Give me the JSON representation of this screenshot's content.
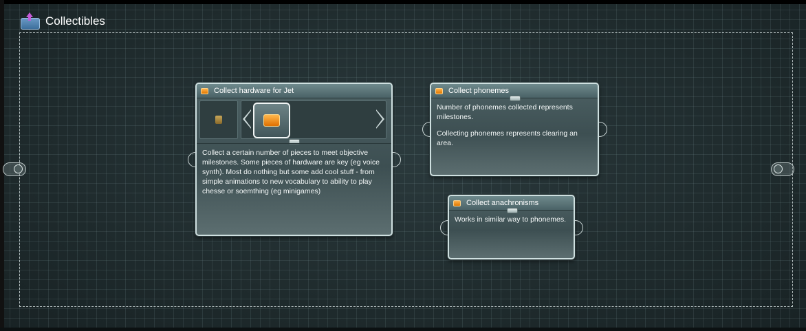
{
  "group": {
    "title": "Collectibles",
    "icon": "box-upload-icon"
  },
  "nodes": {
    "hardware": {
      "title": "Collect hardware for Jet",
      "icon": "orange-chip-icon",
      "description": "Collect a certain number of pieces to meet objective milestones. Some pieces of hardware are key (eg voice synth). Most do nothing but some add cool stuff - from simple animations to new vocabulary to ability to play chesse or soemthing (eg minigames)"
    },
    "phonemes": {
      "title": "Collect phonemes",
      "icon": "orange-chip-icon",
      "paragraphs": [
        "Number of phonemes collected represents milestones.",
        "Collecting phonemes represents clearing an area."
      ]
    },
    "anachronisms": {
      "title": "Collect anachronisms",
      "icon": "orange-chip-icon",
      "description": "Works in similar way to phonemes."
    }
  },
  "colors": {
    "accent": "#f0920f",
    "node_border": "#cfe0e0",
    "background": "#1e2a2c"
  }
}
